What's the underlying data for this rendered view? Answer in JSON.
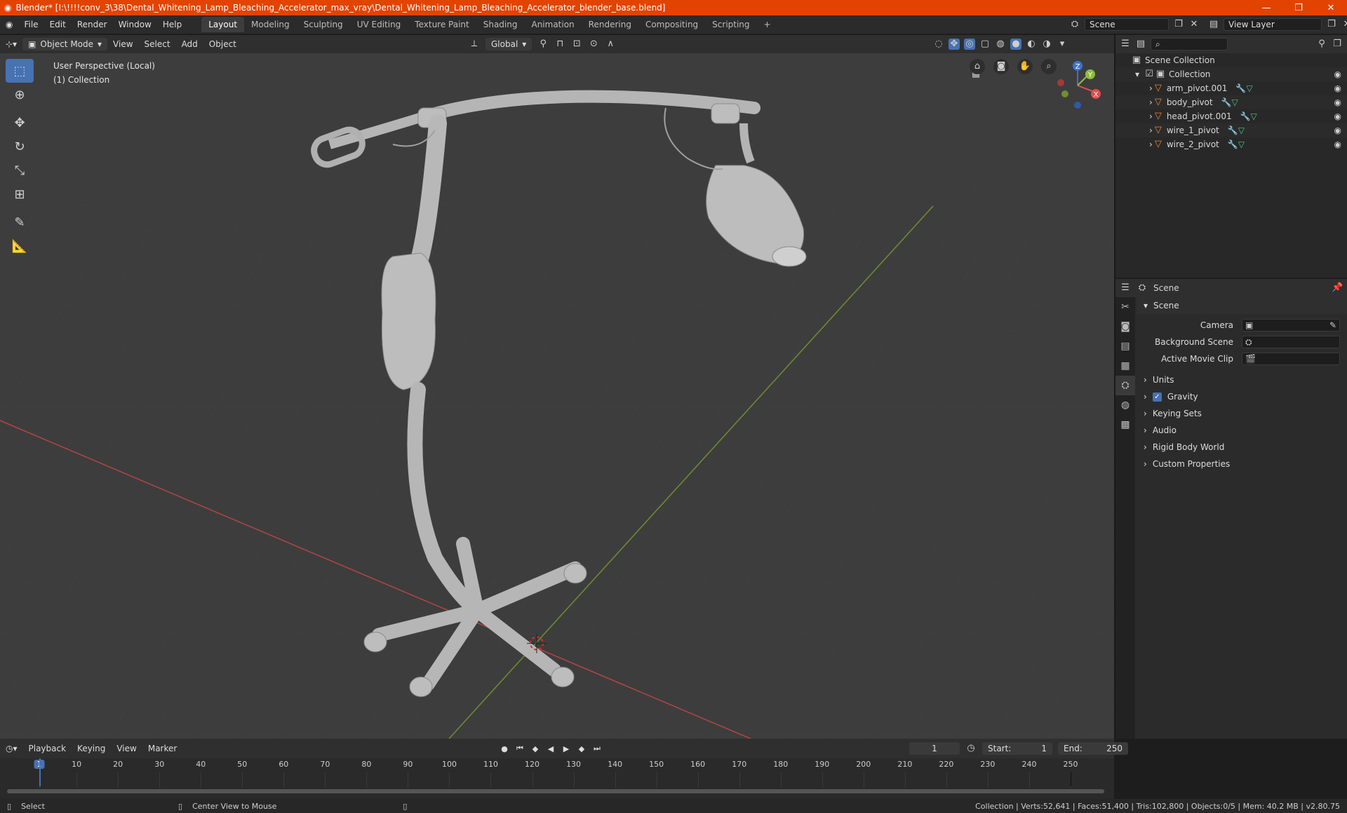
{
  "window": {
    "title": "Blender* [I:\\!!!!conv_3\\38\\Dental_Whitening_Lamp_Bleaching_Accelerator_max_vray\\Dental_Whitening_Lamp_Bleaching_Accelerator_blender_base.blend]",
    "minimize": "—",
    "restore": "❐",
    "close": "✕"
  },
  "menu": [
    "File",
    "Edit",
    "Render",
    "Window",
    "Help"
  ],
  "workspaces": [
    "Layout",
    "Modeling",
    "Sculpting",
    "UV Editing",
    "Texture Paint",
    "Shading",
    "Animation",
    "Rendering",
    "Compositing",
    "Scripting"
  ],
  "active_workspace": "Layout",
  "scene_selector": "Scene",
  "view_layer": "View Layer",
  "viewport": {
    "mode": "Object Mode",
    "menus": [
      "View",
      "Select",
      "Add",
      "Object"
    ],
    "transform_orientation": "Global",
    "info_line1": "User Perspective (Local)",
    "info_line2": "(1) Collection",
    "gizmo_axes": {
      "x": "X",
      "y": "Y",
      "z": "Z"
    }
  },
  "outliner": {
    "root": "Scene Collection",
    "collection": "Collection",
    "items": [
      "arm_pivot.001",
      "body_pivot",
      "head_pivot.001",
      "wire_1_pivot",
      "wire_2_pivot"
    ]
  },
  "properties": {
    "context": "Scene",
    "panel": "Scene",
    "fields": [
      {
        "label": "Camera",
        "value": ""
      },
      {
        "label": "Background Scene",
        "value": ""
      },
      {
        "label": "Active Movie Clip",
        "value": ""
      }
    ],
    "subpanels": [
      "Units",
      "Gravity",
      "Keying Sets",
      "Audio",
      "Rigid Body World",
      "Custom Properties"
    ],
    "gravity_checked": true
  },
  "timeline": {
    "menus": [
      "Playback",
      "Keying",
      "View",
      "Marker"
    ],
    "current_frame": "1",
    "start_label": "Start:",
    "start": "1",
    "end_label": "End:",
    "end": "250",
    "ticks": [
      "1",
      "10",
      "20",
      "30",
      "40",
      "50",
      "60",
      "70",
      "80",
      "90",
      "100",
      "110",
      "120",
      "130",
      "140",
      "150",
      "160",
      "170",
      "180",
      "190",
      "200",
      "210",
      "220",
      "230",
      "240",
      "250"
    ]
  },
  "status": {
    "select": "Select",
    "center": "Center View to Mouse",
    "stats": "Collection | Verts:52,641 | Faces:51,400 | Tris:102,800 | Objects:0/5 | Mem: 40.2 MB | v2.80.75"
  },
  "colors": {
    "accent": "#e24400",
    "active_tool": "#4772b3",
    "x_axis": "#e34c4c",
    "y_axis": "#8fbc3c",
    "z_axis": "#3c72d1"
  }
}
